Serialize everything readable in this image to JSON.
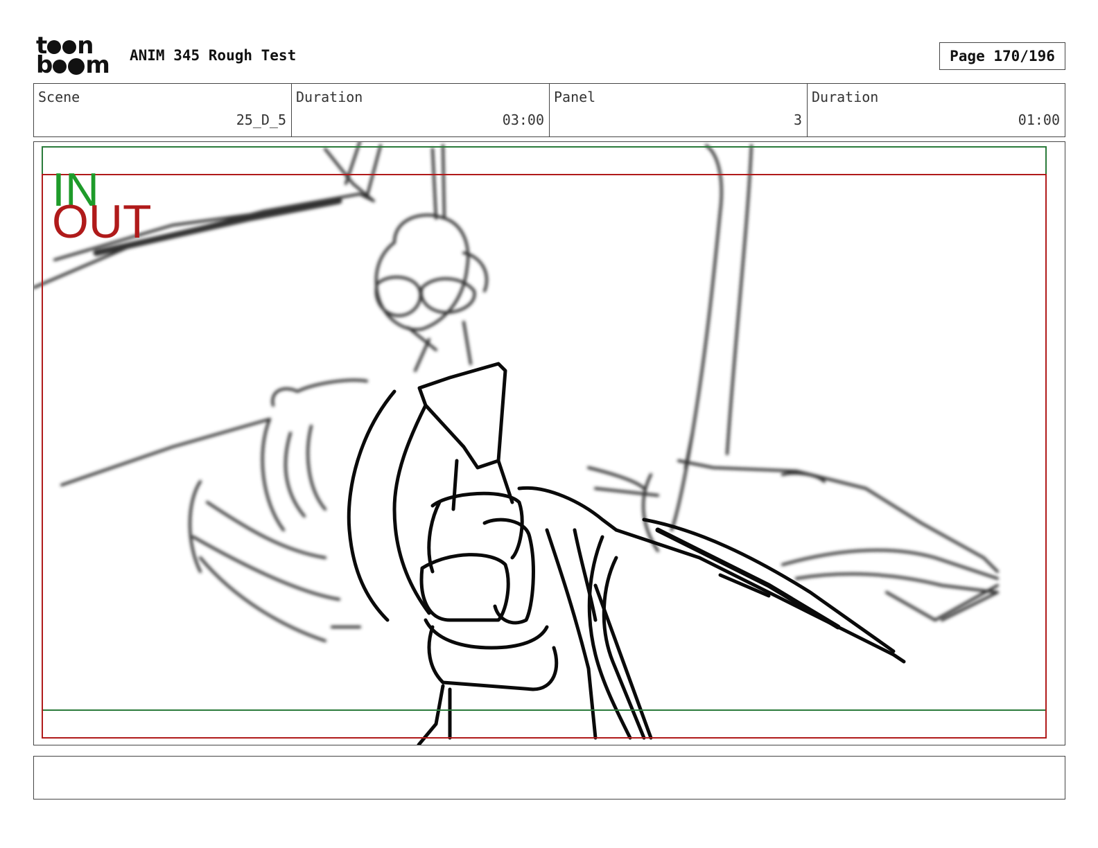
{
  "header": {
    "logo_top": "t",
    "logo_top_end": "n",
    "logo_bottom": "b",
    "logo_bottom_end": "m",
    "title": "ANIM 345 Rough Test",
    "page": "Page 170/196"
  },
  "info": {
    "scene_label": "Scene",
    "scene_value": "25_D_5",
    "duration_label": "Duration",
    "duration_value": "03:00",
    "panel_label": "Panel",
    "panel_value": "3",
    "panel_duration_label": "Duration",
    "panel_duration_value": "01:00"
  },
  "panel": {
    "in_label": "IN",
    "out_label": "OUT",
    "in_color": "#1e9b2a",
    "out_color": "#b01a1a"
  },
  "caption": {
    "text": ""
  }
}
